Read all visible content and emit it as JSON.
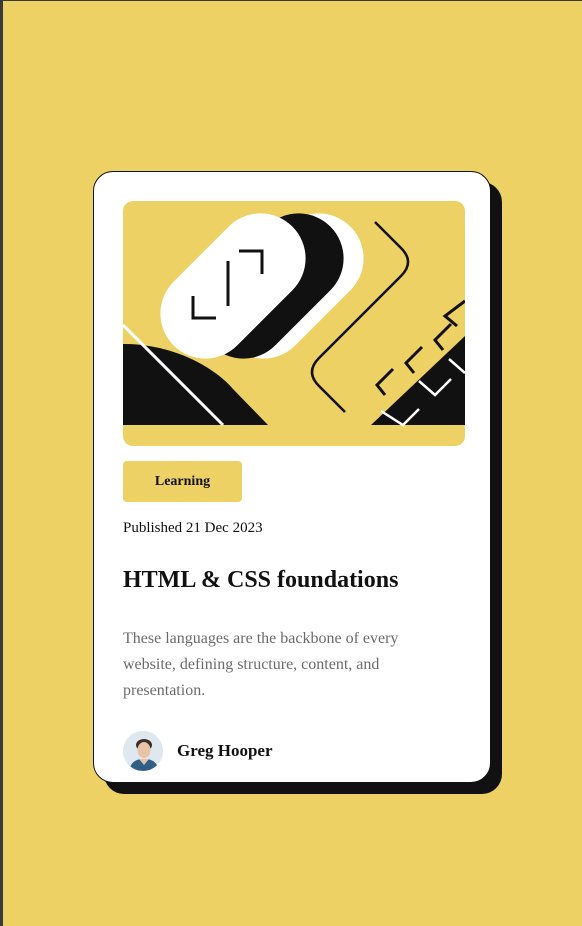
{
  "page": {
    "background": "#EDD164"
  },
  "card": {
    "illustration_icon": "abstract-geometric-illustration",
    "tag": "Learning",
    "published": "Published 21 Dec 2023",
    "title": "HTML & CSS foundations",
    "description": "These languages are the backbone of every website, defining structure, content, and presentation.",
    "author": {
      "name": "Greg Hooper",
      "avatar_icon": "avatar-photo"
    }
  },
  "colors": {
    "accent_yellow": "#EDD164",
    "ink": "#111111",
    "muted_text": "#6B6B6B",
    "card_bg": "#FFFFFF"
  }
}
